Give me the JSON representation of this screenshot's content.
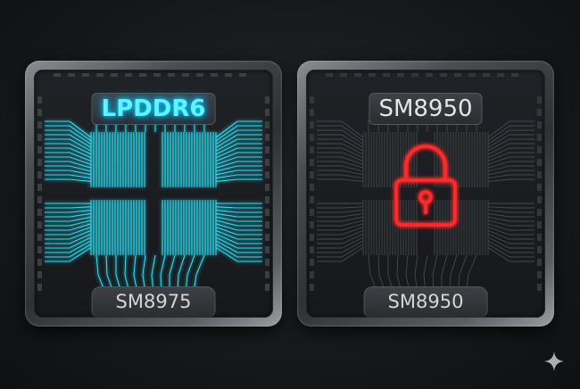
{
  "chips": [
    {
      "id": "left",
      "top_label": "LPDDR6",
      "bottom_label": "SM8975",
      "state": "active",
      "accent": "#19e3ff"
    },
    {
      "id": "right",
      "top_label": "SM8950",
      "bottom_label": "SM8950",
      "state": "locked",
      "accent": "#ff2a2a"
    }
  ],
  "icons": {
    "lock": "padlock-icon",
    "corner": "sparkle-icon"
  }
}
